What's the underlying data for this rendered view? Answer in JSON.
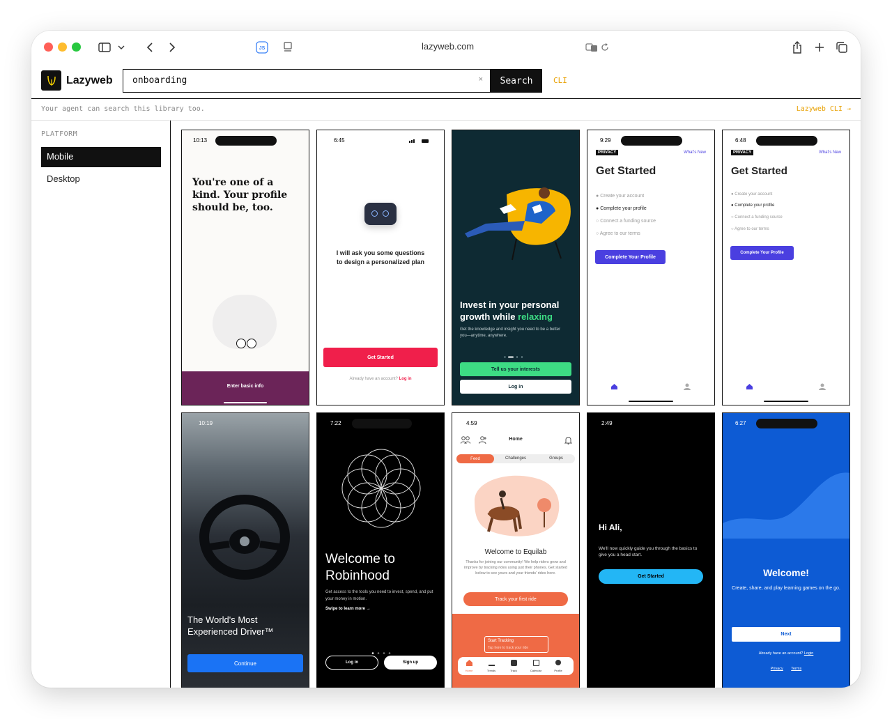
{
  "browser": {
    "url": "lazyweb.com"
  },
  "app": {
    "brand": "Lazyweb",
    "search_value": "onboarding",
    "clear_label": "×",
    "search_button": "Search",
    "cli_label": "CLI",
    "agent_note": "Your agent can search this library too.",
    "cli_link": "Lazyweb CLI →"
  },
  "sidebar": {
    "section_label": "PLATFORM",
    "items": [
      {
        "label": "Mobile",
        "active": true
      },
      {
        "label": "Desktop",
        "active": false
      }
    ]
  },
  "cards": {
    "c1": {
      "time": "10:13",
      "headline": "You're one of a kind. Your profile should be, too.",
      "button": "Enter basic info"
    },
    "c2": {
      "time": "6:45",
      "message": "I will ask you some questions to design a personalized plan",
      "button": "Get Started",
      "footer": "Already have an account?",
      "footer_link": "Log in"
    },
    "c3": {
      "headline1": "Invest in your personal growth while",
      "headline_accent": "relaxing",
      "body": "Get the knowledge and insight you need to be a better you—anytime, anywhere.",
      "button1": "Tell us your interests",
      "button2": "Log in"
    },
    "c4": {
      "time": "9:29",
      "badge": "PRIVACY",
      "whats_new": "What's New",
      "title": "Get Started",
      "steps": [
        "Create your account",
        "Complete your profile",
        "Connect a funding source",
        "Agree to our terms"
      ],
      "button": "Complete Your Profile"
    },
    "c5": {
      "time": "6:48",
      "badge": "PRIVACY",
      "whats_new": "What's New",
      "title": "Get Started",
      "steps": [
        "Create your account",
        "Complete your profile",
        "Connect a funding source",
        "Agree to our terms"
      ],
      "button": "Complete Your Profile"
    },
    "c6": {
      "time": "10:19",
      "headline": "The World's Most Experienced Driver™",
      "button": "Continue"
    },
    "c7": {
      "time": "7:22",
      "headline": "Welcome to Robinhood",
      "body": "Get access to the tools you need to invest, spend, and put your money in motion.",
      "swipe": "Swipe to learn more →",
      "button1": "Log in",
      "button2": "Sign up"
    },
    "c8": {
      "time": "4:59",
      "nav_title": "Home",
      "tabs": [
        "Feed",
        "Challenges",
        "Groups"
      ],
      "title": "Welcome to Equilab",
      "body": "Thanks for joining our community! We help riders grow and improve by tracking rides using just their phones. Get started below to see yours and your friends' rides here.",
      "button": "Track your first ride",
      "tracking_title": "Start Tracking",
      "tracking_sub": "Tap here to track your ride",
      "bottom_tabs": [
        "Home",
        "Trends",
        "Track",
        "Calendar",
        "Profile"
      ]
    },
    "c9": {
      "time": "2:49",
      "headline": "Hi Ali,",
      "body": "We'll now quickly guide you through the basics to give you a head start.",
      "button": "Get Started"
    },
    "c10": {
      "time": "6:27",
      "headline": "Welcome!",
      "body": "Create, share, and play learning games on the go.",
      "button": "Next",
      "footer": "Already have an account?",
      "footer_link": "Login",
      "links": [
        "Privacy",
        "Terms"
      ]
    }
  },
  "colors": {
    "accent_orange": "#e8a000",
    "card1_purple": "#6b2458",
    "card2_red": "#f01f4b",
    "card3_green": "#3ddc84",
    "card4_blue": "#4a3fe0",
    "card10_blue": "#0d5bd4"
  }
}
